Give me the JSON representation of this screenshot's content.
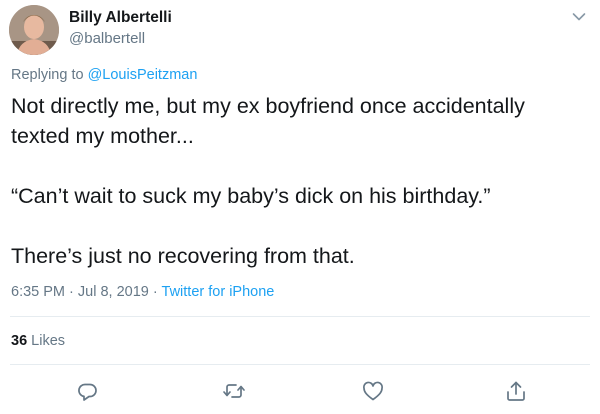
{
  "tweet": {
    "display_name": "Billy Albertelli",
    "handle": "@balbertell",
    "replying_prefix": "Replying to",
    "replying_to": "@LouisPeitzman",
    "paragraphs": [
      "Not directly me, but my ex boyfriend once accidentally texted my mother...",
      "“Can’t wait to suck my baby’s dick on his birthday.”",
      "There’s just no recovering from that."
    ],
    "time": "6:35 PM",
    "date": "Jul 8, 2019",
    "separator": "·",
    "source": "Twitter for iPhone",
    "likes_count": "36",
    "likes_label": "Likes"
  },
  "icons": {
    "menu": "chevron-down-icon",
    "reply": "reply-icon",
    "retweet": "retweet-icon",
    "like": "heart-icon",
    "share": "share-icon"
  },
  "colors": {
    "text": "#14171a",
    "secondary": "#657786",
    "link": "#1da1f2",
    "divider": "#e6ecf0"
  }
}
